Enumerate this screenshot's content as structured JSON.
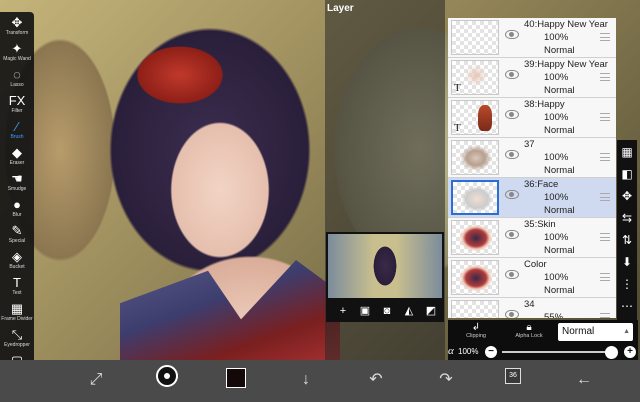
{
  "panel_title": "Layer",
  "tools": [
    {
      "icon": "move-arrows-icon",
      "glyph": "✥",
      "label": "Transform"
    },
    {
      "icon": "magic-wand-icon",
      "glyph": "✦",
      "label": "Magic Wand"
    },
    {
      "icon": "lasso-icon",
      "glyph": "◌",
      "label": "Lasso"
    },
    {
      "icon": "filter-icon",
      "glyph": "FX",
      "label": "Filter"
    },
    {
      "icon": "brush-icon",
      "glyph": "∕",
      "label": "Brush"
    },
    {
      "icon": "eraser-icon",
      "glyph": "◆",
      "label": "Eraser"
    },
    {
      "icon": "smudge-icon",
      "glyph": "☚",
      "label": "Smudge"
    },
    {
      "icon": "blur-icon",
      "glyph": "●",
      "label": "Blur"
    },
    {
      "icon": "special-icon",
      "glyph": "✎",
      "label": "Special"
    },
    {
      "icon": "bucket-icon",
      "glyph": "◈",
      "label": "Bucket"
    },
    {
      "icon": "text-icon",
      "glyph": "T",
      "label": "Text"
    },
    {
      "icon": "frame-divider-icon",
      "glyph": "▦",
      "label": "Frame Divider"
    },
    {
      "icon": "eyedropper-icon",
      "glyph": "⤡",
      "label": "Eyedropper"
    },
    {
      "icon": "canvas-icon",
      "glyph": "▢",
      "label": "Canvas"
    }
  ],
  "layers": [
    {
      "name": "40:Happy New Year",
      "opacity": "100%",
      "blend": "Normal",
      "thumb": "empty"
    },
    {
      "name": "39:Happy New Year",
      "opacity": "100%",
      "blend": "Normal",
      "thumb": "text"
    },
    {
      "name": "38:Happy",
      "opacity": "100%",
      "blend": "Normal",
      "thumb": "text-red"
    },
    {
      "name": "37",
      "opacity": "100%",
      "blend": "Normal",
      "thumb": "sketch"
    },
    {
      "name": "36:Face",
      "opacity": "100%",
      "blend": "Normal",
      "thumb": "face",
      "selected": true
    },
    {
      "name": "35:Skin",
      "opacity": "100%",
      "blend": "Normal",
      "thumb": "color"
    },
    {
      "name": "Color",
      "opacity": "100%",
      "blend": "Normal",
      "thumb": "color"
    },
    {
      "name": "34",
      "opacity": "55%",
      "blend": "",
      "thumb": "empty"
    }
  ],
  "blend_bar": {
    "clipping_label": "Clipping",
    "alpha_lock_label": "Alpha Lock",
    "blend_mode": "Normal"
  },
  "opacity": {
    "symbol": "α",
    "value": "100%",
    "minus": "−",
    "plus": "+"
  },
  "preview_buttons": [
    "+",
    "▣",
    "◙",
    "◭",
    "◩"
  ],
  "layer_tools": [
    "▦",
    "◧",
    "✥",
    "⇆",
    "⇅",
    "⬇",
    "⋮",
    "⋯"
  ],
  "bottom_bar": {
    "layer_count": "36"
  },
  "colors": {
    "current_color": "#140808",
    "selected_layer": "#cfd9f0",
    "accent": "#2a6fd6"
  }
}
